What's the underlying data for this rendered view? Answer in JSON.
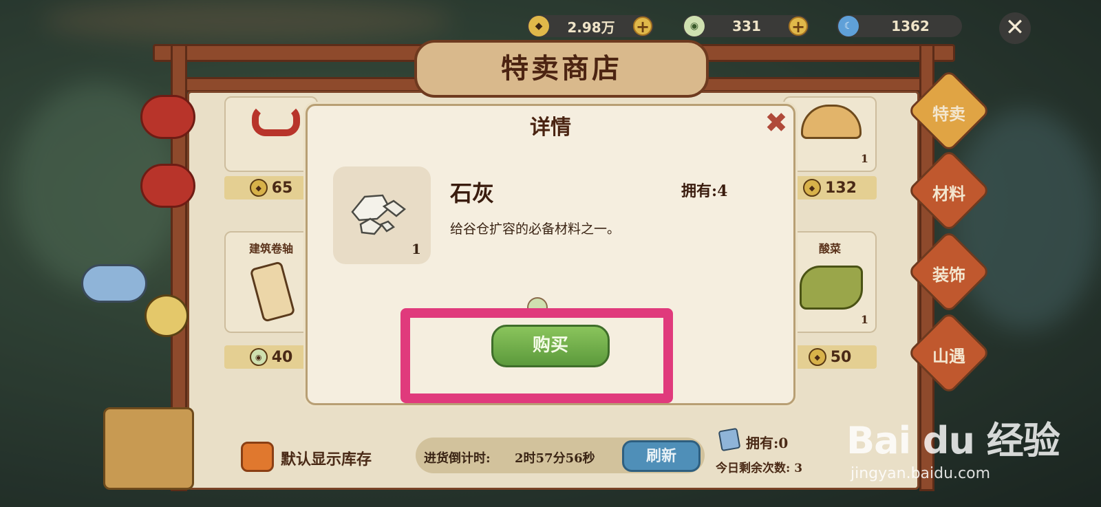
{
  "currencies": [
    {
      "value": "2.98万",
      "icon": "diamond-coin-icon",
      "has_plus": true
    },
    {
      "value": "331",
      "icon": "jade-coin-icon",
      "has_plus": true
    },
    {
      "value": "1362",
      "icon": "moon-icon",
      "has_plus": false
    }
  ],
  "shop": {
    "title": "特卖商店",
    "items": [
      {
        "name": "",
        "qty": "",
        "price": "65"
      },
      {
        "name": "",
        "qty": "1",
        "price": "132"
      },
      {
        "name": "建筑卷轴",
        "qty": "",
        "price": "40"
      },
      {
        "name": "酸菜",
        "qty": "1",
        "price": "50"
      }
    ],
    "tabs": [
      "特卖",
      "材料",
      "装饰",
      "山遇"
    ]
  },
  "footer": {
    "default_stock_label": "默认显示库存",
    "restock_label": "进货倒计时:",
    "restock_time": "2时57分56秒",
    "refresh_label": "刷新",
    "owned_label": "拥有:0",
    "remaining_label": "今日剩余次数: 3"
  },
  "modal": {
    "title": "详情",
    "item_name": "石灰",
    "item_qty": "1",
    "owned": "拥有:4",
    "description": "给谷仓扩容的必备材料之一。",
    "buy_label": "购买"
  },
  "watermark": {
    "logo": "Bai du 经验",
    "url": "jingyan.baidu.com"
  }
}
